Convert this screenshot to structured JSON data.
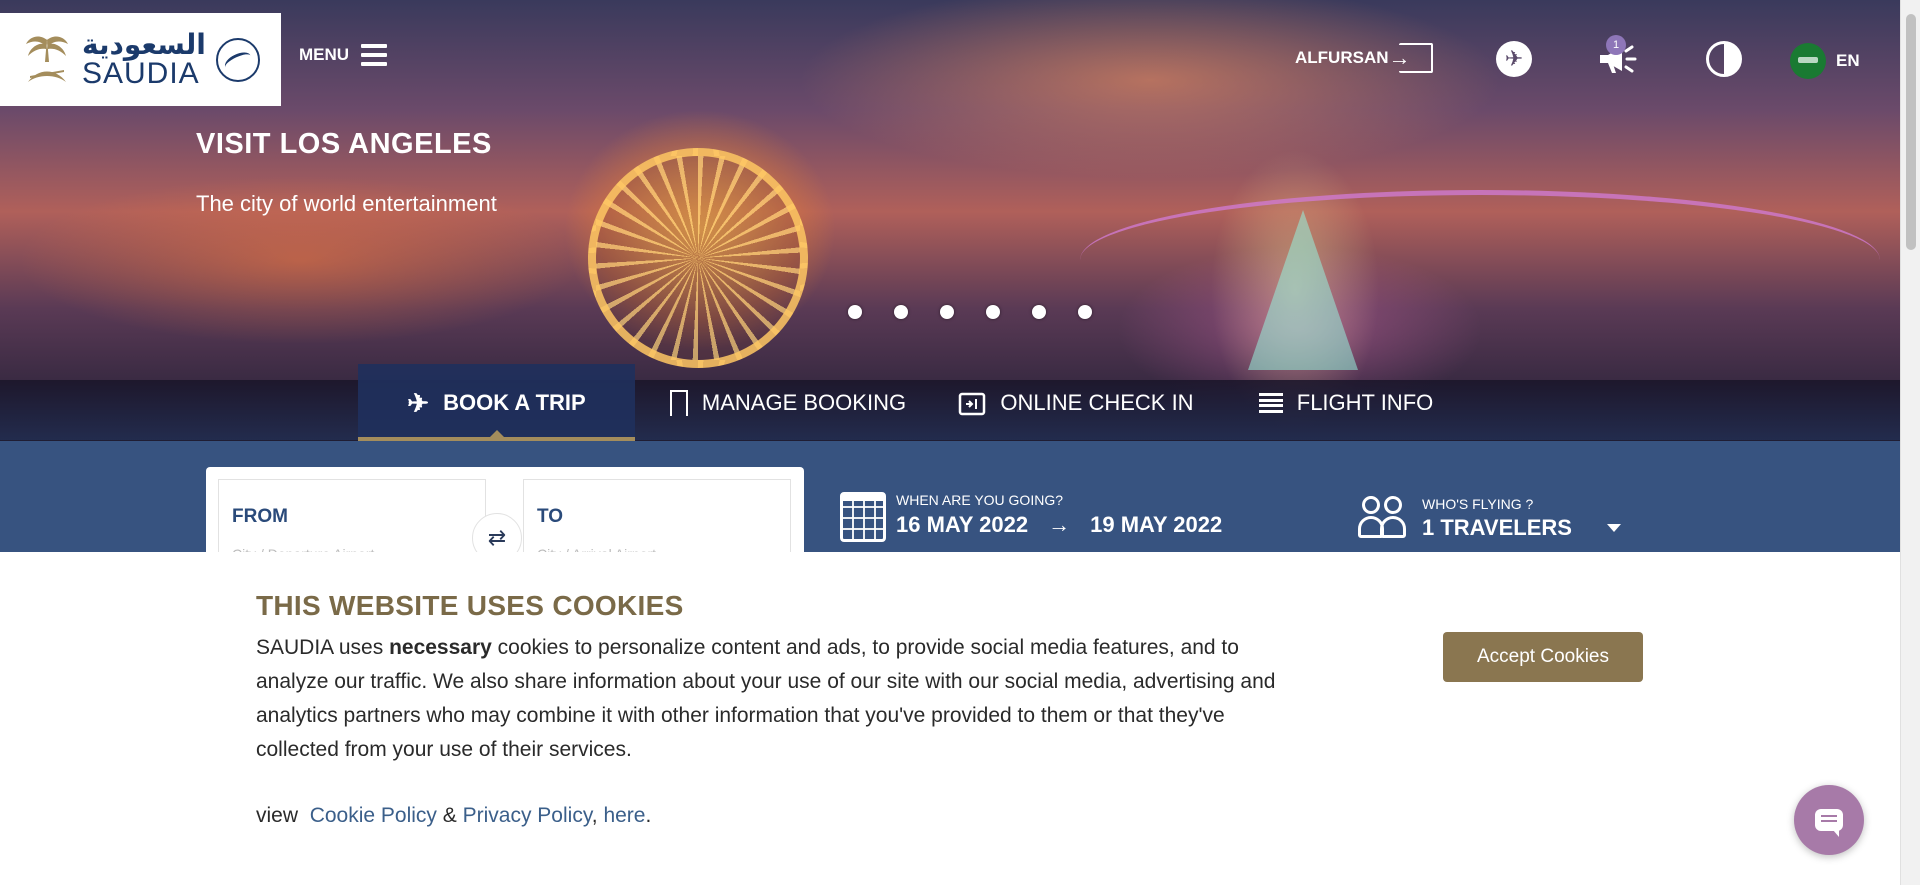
{
  "brand": {
    "arabic": "السعودية",
    "latin": "SAUDIA"
  },
  "header": {
    "menu_label": "MENU",
    "alfursan_label": "ALFURSAN",
    "notification_count": "1",
    "language": "EN"
  },
  "hero": {
    "title": "VISIT LOS ANGELES",
    "subtitle": "The city of world entertainment",
    "slide_count": 6
  },
  "tabs": [
    {
      "label": "BOOK A TRIP",
      "icon": "plane-icon",
      "active": true
    },
    {
      "label": "MANAGE BOOKING",
      "icon": "bookmark-icon",
      "active": false
    },
    {
      "label": "ONLINE CHECK IN",
      "icon": "checkin-icon",
      "active": false
    },
    {
      "label": "FLIGHT INFO",
      "icon": "list-icon",
      "active": false
    }
  ],
  "booking": {
    "from_label": "FROM",
    "from_placeholder": "City / Departure Airport",
    "to_label": "TO",
    "to_placeholder": "City / Arrival Airport",
    "dates_label": "WHEN ARE YOU GOING?",
    "depart_date": "16 MAY 2022",
    "arrow": "→",
    "return_date": "19 MAY 2022",
    "travelers_label": "WHO'S FLYING ?",
    "travelers_value": "1 TRAVELERS"
  },
  "cookie": {
    "title": "THIS WEBSITE USES COOKIES",
    "text_before": "SAUDIA uses ",
    "text_bold": "necessary",
    "text_after": " cookies to personalize content and ads, to provide social media features, and to analyze our traffic. We also share information about your use of our site with our social media, advertising and analytics partners who may combine it with other information that you've provided to them or that they've collected from your use of their services.",
    "view_label": "view",
    "cookie_policy_link": "Cookie Policy",
    "amp": "&",
    "privacy_policy_link": "Privacy Policy",
    "comma": ",",
    "here_link": "here",
    "period": ".",
    "accept_label": "Accept Cookies"
  },
  "colors": {
    "brand_gold": "#8a7650",
    "title_gold": "#7a6a48",
    "navy": "#1b3a6b",
    "booking_strip": "#375380",
    "link": "#3b5f8a",
    "chat": "#a77aa8"
  }
}
